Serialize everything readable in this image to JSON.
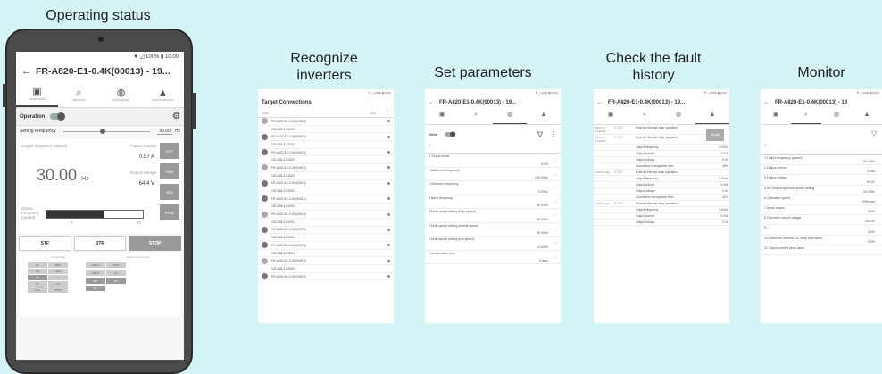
{
  "captions": {
    "operating_status": "Operating status",
    "recognize": "Recognize inverters",
    "set_params": "Set parameters",
    "fault_history": "Check the fault history",
    "monitor": "Monitor"
  },
  "status_bar": "▼ ◿ 100% ▮ 10:00",
  "phone": {
    "title": "FR-A820-E1-0.4K(00013) - 19...",
    "tabs": [
      {
        "label": "DASHBOARD",
        "icon": "▣"
      },
      {
        "label": "MONITOR",
        "icon": "⌕"
      },
      {
        "label": "PARAMETER",
        "icon": "◍"
      },
      {
        "label": "FAULTS HISTORY",
        "icon": "▲"
      }
    ],
    "operation_label": "Operation",
    "setting_frequency_label": "Setting Frequency",
    "setting_frequency_value": "30.00",
    "setting_frequency_unit": "Hz",
    "output_frequency_label": "Output frequency (speed)",
    "output_frequency_value": "30.00",
    "output_frequency_unit": "Hz",
    "output_current_label": "Output current",
    "output_current_value": "0.57 A",
    "output_voltage_label": "Output voltage",
    "output_voltage_value": "64.4 V",
    "status_frequency_label": "Status frequency (speed)",
    "bar_min": "0",
    "bar_max": "50",
    "bar_fill_fraction": 0.6,
    "side_buttons": [
      "STR",
      "FWD",
      "REV",
      "PR-M"
    ],
    "cmd_buttons": [
      "STF",
      "STR",
      "STOP"
    ],
    "io_label_left": "I/O terminal",
    "io_label_right": "Option I/O terminal",
    "io_cells": [
      "RL",
      "MRS",
      "RM",
      "RES",
      "RH",
      "AU",
      "RT",
      "CS",
      "JOG",
      "STOP"
    ],
    "io_cells_right": [
      "ABC1",
      "RUN",
      "ABC2",
      "SU",
      "IPF",
      "FU",
      "OL"
    ]
  },
  "recognize": {
    "title": "Target Connections",
    "scan_label": "Scan",
    "add_label": "Add",
    "items": [
      "FR-A820-E1-0.4K(00013)",
      "192.168.3.1:5010",
      "FR-A820-E1-0.4K(00013)",
      "192.168.3.1:5012",
      "FR-A820-E1-0.4K(00013)",
      "192.168.3.2:5010",
      "FR-A820-E1-0.4K(00013)",
      "192.168.3.2:5012",
      "FR-A820-E1-0.4K(00013)",
      "192.168.3.3:5010",
      "FR-A820-E1-0.4K(00013)",
      "192.168.3.4:5010",
      "FR-A820-E1-0.4K(00013)",
      "192.168.3.4:5012",
      "FR-A820-E1-0.4K(00013)",
      "192.168.3.5:5010",
      "FR-A820-E1-0.4K(00013)",
      "192.168.3.5:5012",
      "FR-A820-E1-0.4K(00013)",
      "192.168.3.6:5010",
      "FR-A820-E1-0.4K(00013)"
    ]
  },
  "set_params": {
    "title": "FR-A820-E1-0.4K(00013) - 19...",
    "write_label": "Write",
    "params": [
      {
        "label": "0 Torque boost",
        "value": "6.0%"
      },
      {
        "label": "1 Maximum frequency",
        "value": "120.00Hz"
      },
      {
        "label": "2 Minimum frequency",
        "value": "0.00Hz"
      },
      {
        "label": "3 Base frequency",
        "value": "60.00Hz"
      },
      {
        "label": "4 Multi-speed setting (high speed)",
        "value": "60.00Hz"
      },
      {
        "label": "5 Multi-speed setting (middle speed)",
        "value": "30.00Hz"
      },
      {
        "label": "6 Multi-speed setting (low speed)",
        "value": "10.00Hz"
      },
      {
        "label": "7 Acceleration time",
        "value": "5.0sec"
      }
    ]
  },
  "fault_history": {
    "title": "FR-A820-E1-0.4K(00013) - 19...",
    "reset_label": "Reset",
    "rows": [
      {
        "a": "Alarm in progress",
        "b": "E.OHT",
        "c": "External thermal relay operation",
        "d": ""
      },
      {
        "a": "Alarm in progress",
        "b": "E.OHT",
        "c": "External thermal relay operation",
        "d": ""
      },
      {
        "a": "",
        "b": "",
        "c": "Output frequency",
        "d": "0.00Hz"
      },
      {
        "a": "",
        "b": "",
        "c": "Output current",
        "d": "0.00A"
      },
      {
        "a": "",
        "b": "",
        "c": "Output voltage",
        "d": "0.0V"
      },
      {
        "a": "",
        "b": "",
        "c": "Cumulative energization time",
        "d": "40Hr"
      },
      {
        "a": "2 times ago",
        "b": "E.OHT",
        "c": "External thermal relay operation",
        "d": ""
      },
      {
        "a": "",
        "b": "",
        "c": "Output frequency",
        "d": "0.00Hz"
      },
      {
        "a": "",
        "b": "",
        "c": "Output current",
        "d": "0.00A"
      },
      {
        "a": "",
        "b": "",
        "c": "Output voltage",
        "d": "0.0V"
      },
      {
        "a": "",
        "b": "",
        "c": "Cumulative energization time",
        "d": "41Hr"
      },
      {
        "a": "3 times ago",
        "b": "E.OHT",
        "c": "External thermal relay operation",
        "d": ""
      },
      {
        "a": "",
        "b": "",
        "c": "Output frequency",
        "d": "0.00Hz"
      },
      {
        "a": "",
        "b": "",
        "c": "Output current",
        "d": "0.00A"
      },
      {
        "a": "",
        "b": "",
        "c": "Output voltage",
        "d": "0.0V"
      }
    ]
  },
  "monitor": {
    "title": "FR-A820-E1-0.4K(00013) - 19",
    "items": [
      {
        "label": "1 Output frequency (speed)",
        "value": "30.00Hz"
      },
      {
        "label": "2 Output current",
        "value": "0.56A"
      },
      {
        "label": "3 Output voltage",
        "value": "64.2V"
      },
      {
        "label": "5 Set frequency/motor speed setting",
        "value": "30.00Hz"
      },
      {
        "label": "6 Operation speed",
        "value": "900r/min"
      },
      {
        "label": "7 Motor torque",
        "value": "0.0%"
      },
      {
        "label": "8 Converter output voltage",
        "value": "293.0V"
      },
      {
        "label": "9 --",
        "value": "0.0%"
      },
      {
        "label": "10 Electronic thermal O/L relay load factor",
        "value": "0.0%"
      },
      {
        "label": "11 Output current peak value",
        "value": ""
      }
    ]
  }
}
